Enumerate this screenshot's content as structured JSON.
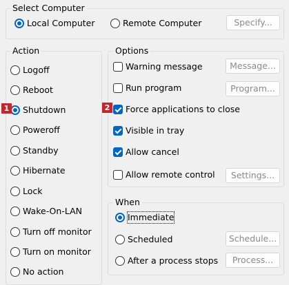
{
  "select_computer": {
    "legend": "Select Computer",
    "local_label": "Local Computer",
    "remote_label": "Remote Computer",
    "specify_label": "Specify..."
  },
  "action": {
    "legend": "Action",
    "items": [
      "Logoff",
      "Reboot",
      "Shutdown",
      "Poweroff",
      "Standby",
      "Hibernate",
      "Lock",
      "Wake-On-LAN",
      "Turn off monitor",
      "Turn on monitor",
      "No action"
    ],
    "selected": "Shutdown"
  },
  "options": {
    "legend": "Options",
    "warning_label": "Warning message",
    "message_btn": "Message...",
    "run_label": "Run program",
    "program_btn": "Program...",
    "force_label": "Force applications to close",
    "visible_label": "Visible in tray",
    "allow_cancel_label": "Allow cancel",
    "allow_remote_label": "Allow remote control",
    "settings_btn": "Settings..."
  },
  "when": {
    "legend": "When",
    "immediate_label": "Immediate",
    "scheduled_label": "Scheduled",
    "schedule_btn": "Schedule...",
    "after_label": "After a process stops",
    "process_btn": "Process..."
  },
  "badges": {
    "b1": "1",
    "b2": "2"
  },
  "colors": {
    "accent": "#0067c0",
    "badge": "#c0282d",
    "disabled_text": "#8a8a8a"
  }
}
